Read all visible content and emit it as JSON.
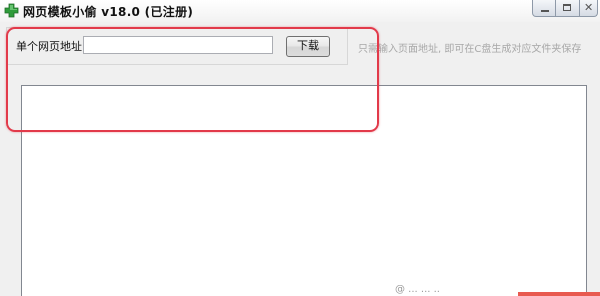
{
  "window": {
    "title": "网页模板小偷 v18.0 (已注册)",
    "close_symbol": "✕"
  },
  "form": {
    "url_label": "单个网页地址",
    "url_value": "",
    "url_placeholder": "",
    "download_label": "下载",
    "hint": "只需输入页面地址, 即可在C盘生成对应文件夹保存"
  },
  "log": {
    "content": ""
  },
  "watermark": "@ ... ... ..",
  "colors": {
    "annotation": "#e23a4a",
    "app_icon": "#2e9b3a"
  },
  "icons": {
    "app": "green-plus-icon"
  }
}
